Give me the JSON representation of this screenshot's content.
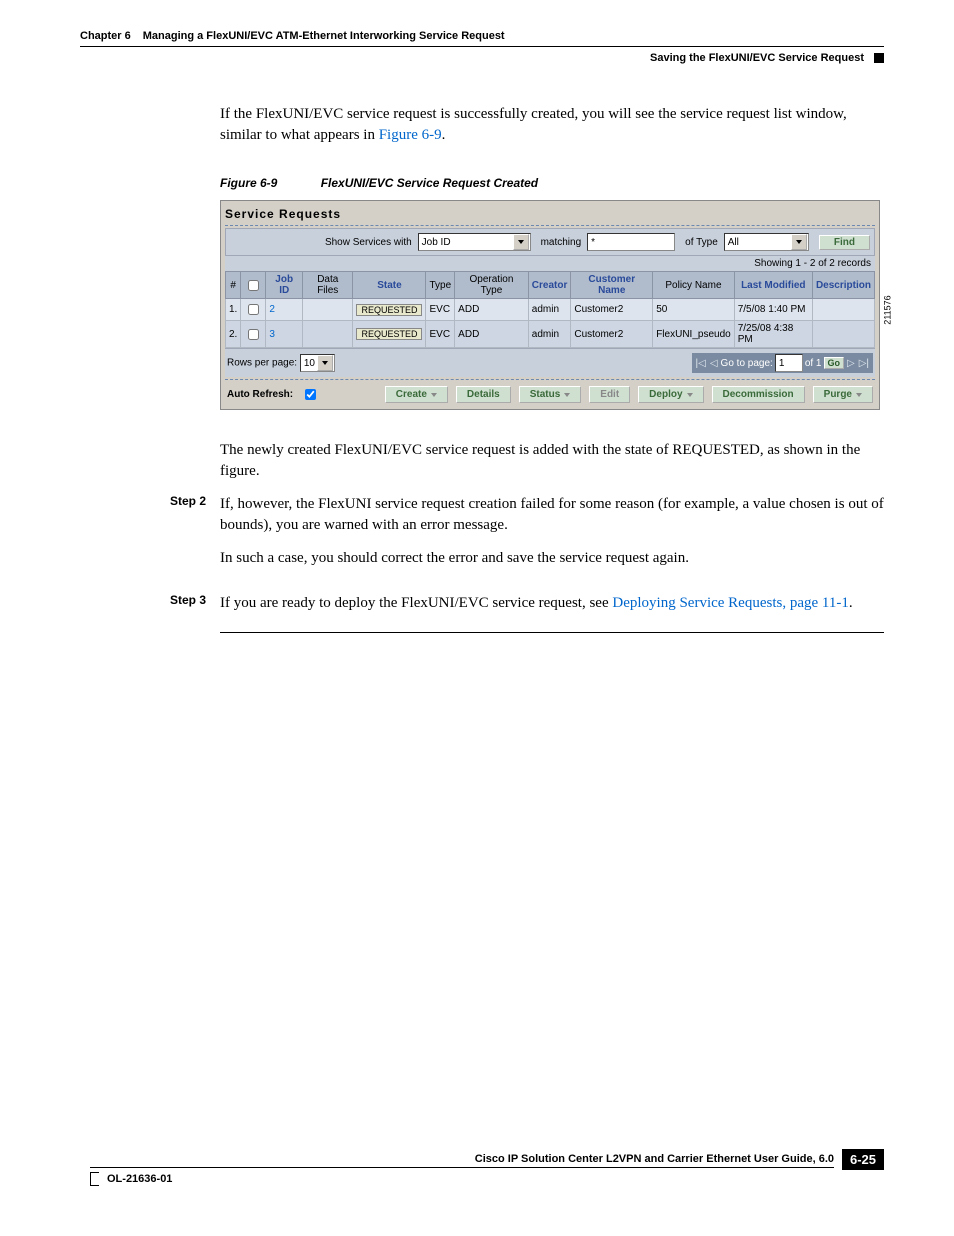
{
  "header": {
    "chapter": "Chapter 6",
    "title": "Managing a FlexUNI/EVC ATM-Ethernet Interworking Service Request",
    "section": "Saving the FlexUNI/EVC Service Request"
  },
  "intro": {
    "text_before_link": "If the FlexUNI/EVC service request is successfully created, you will see the service request list window, similar to what appears in ",
    "link": "Figure 6-9",
    "text_after_link": "."
  },
  "figure": {
    "number": "Figure 6-9",
    "title": "FlexUNI/EVC Service Request Created",
    "image_id": "211576",
    "panel_title": "Service Requests",
    "filter": {
      "show_label": "Show Services with",
      "show_field_value": "Job ID",
      "matching_label": "matching",
      "matching_value": "*",
      "of_type_label": "of Type",
      "of_type_value": "All",
      "find_button": "Find"
    },
    "showing_text": "Showing 1 - 2 of 2 records",
    "columns": {
      "num": "#",
      "check": "",
      "job_id": "Job ID",
      "data_files": "Data Files",
      "state": "State",
      "type": "Type",
      "op_type": "Operation Type",
      "creator": "Creator",
      "customer": "Customer Name",
      "policy": "Policy Name",
      "last_mod": "Last Modified",
      "desc": "Description"
    },
    "rows": [
      {
        "num": "1.",
        "job_id": "2",
        "state": "REQUESTED",
        "type": "EVC",
        "op_type": "ADD",
        "creator": "admin",
        "customer": "Customer2",
        "policy": "50",
        "last_mod": "7/5/08 1:40 PM",
        "desc": ""
      },
      {
        "num": "2.",
        "job_id": "3",
        "state": "REQUESTED",
        "type": "EVC",
        "op_type": "ADD",
        "creator": "admin",
        "customer": "Customer2",
        "policy": "FlexUNI_pseudo",
        "last_mod": "7/25/08 4:38 PM",
        "desc": ""
      }
    ],
    "pager": {
      "rows_label": "Rows per page:",
      "rows_value": "10",
      "goto_label": "Go to page:",
      "goto_value": "1",
      "of_label": "of 1",
      "go_button": "Go"
    },
    "bottom": {
      "auto_refresh_label": "Auto Refresh:",
      "buttons": {
        "create": "Create",
        "details": "Details",
        "status": "Status",
        "edit": "Edit",
        "deploy": "Deploy",
        "decommission": "Decommission",
        "purge": "Purge"
      }
    }
  },
  "para_after_figure": "The newly created FlexUNI/EVC service request is added with the state of REQUESTED, as shown in the figure.",
  "step2": {
    "label": "Step 2",
    "p1": "If, however, the FlexUNI service request creation failed for some reason (for example, a value chosen is out of bounds), you are warned with an error message.",
    "p2": "In such a case, you should correct the error and save the service request again."
  },
  "step3": {
    "label": "Step 3",
    "text_before_link": "If you are ready to deploy the FlexUNI/EVC service request, see ",
    "link": "Deploying Service Requests, page 11-1",
    "text_after_link": "."
  },
  "footer": {
    "guide": "Cisco IP Solution Center L2VPN and Carrier Ethernet User Guide, 6.0",
    "doc_id": "OL-21636-01",
    "page": "6-25"
  }
}
